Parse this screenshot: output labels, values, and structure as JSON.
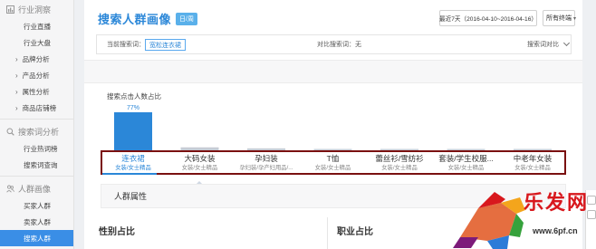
{
  "sidebar": {
    "sections": [
      {
        "label": "行业洞察",
        "icon": "chart-icon",
        "items": [
          {
            "label": "行业直播",
            "arrow": false
          },
          {
            "label": "行业大盘",
            "arrow": false
          },
          {
            "label": "品牌分析",
            "arrow": true
          },
          {
            "label": "产品分析",
            "arrow": true
          },
          {
            "label": "属性分析",
            "arrow": true
          },
          {
            "label": "商品店铺榜",
            "arrow": true
          }
        ]
      },
      {
        "label": "搜索词分析",
        "icon": "search-icon",
        "items": [
          {
            "label": "行业热词榜",
            "arrow": false
          },
          {
            "label": "搜索词查询",
            "arrow": false
          }
        ]
      },
      {
        "label": "人群画像",
        "icon": "people-icon",
        "items": [
          {
            "label": "买家人群",
            "arrow": false
          },
          {
            "label": "卖家人群",
            "arrow": false
          },
          {
            "label": "搜索人群",
            "arrow": false,
            "active": true
          }
        ]
      }
    ]
  },
  "header": {
    "title": "搜索人群画像",
    "tag": "日/周",
    "date_range": "最近7天（2016-04-10~2016-04-16）",
    "terminal": "所有终端"
  },
  "search_bar": {
    "current_label": "当前搜索词：",
    "keyword": "宽松连衣裙",
    "compare_label": "对比搜索词：无",
    "compare_toggle": "搜索词对比"
  },
  "chart_data": {
    "type": "bar",
    "title": "搜索点击人数占比",
    "categories": [
      "连衣裙",
      "大码女装",
      "孕妇装",
      "T恤",
      "蕾丝衫/雪纺衫",
      "套装/学生校服...",
      "中老年女装"
    ],
    "subcategories": [
      "女装/女士精品",
      "女装/女士精品",
      "孕妇装/孕产妇用品/...",
      "女装/女士精品",
      "女装/女士精品",
      "女装/女士精品",
      "女装/女士精品"
    ],
    "values": [
      77,
      6,
      4,
      1,
      0.8,
      0.5,
      0.3
    ],
    "data_labels": [
      "77%",
      "",
      "",
      "",
      "",
      "",
      ""
    ],
    "selected_index": 0,
    "colors": {
      "selected": "#2b87d8",
      "other": "#c6cbd4"
    }
  },
  "section": {
    "heading": "人群属性",
    "left_title": "性别占比",
    "right_title": "职业占比"
  },
  "watermark": {
    "text": "乐发网",
    "url": "www.6pf.cn"
  }
}
